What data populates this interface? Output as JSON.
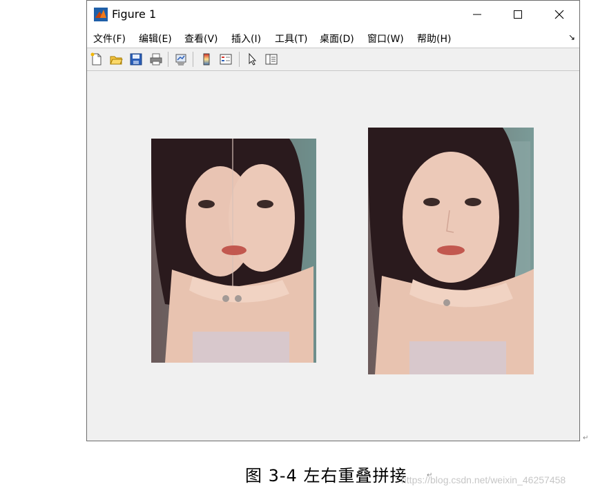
{
  "window": {
    "title": "Figure 1",
    "controls": [
      "minimize-icon",
      "maximize-icon",
      "close-icon"
    ]
  },
  "menu": {
    "items": [
      "文件(F)",
      "编辑(E)",
      "查看(V)",
      "插入(I)",
      "工具(T)",
      "桌面(D)",
      "窗口(W)",
      "帮助(H)"
    ],
    "overflow_icon": "chevron-corner-icon"
  },
  "toolbar": {
    "icons": [
      "new-figure-icon",
      "open-file-icon",
      "save-icon",
      "print-icon",
      "link-plot-icon",
      "colorbar-icon",
      "legend-icon",
      "edit-plot-arrow-icon",
      "property-inspector-icon"
    ]
  },
  "figure": {
    "images": [
      {
        "name": "overlap-stitched-image",
        "description_icon": "photo-icon"
      },
      {
        "name": "original-image",
        "description_icon": "photo-icon"
      }
    ]
  },
  "caption": {
    "text": "图 3-4  左右重叠拼接"
  },
  "watermark": {
    "text": "https://blog.csdn.net/weixin_46257458"
  }
}
